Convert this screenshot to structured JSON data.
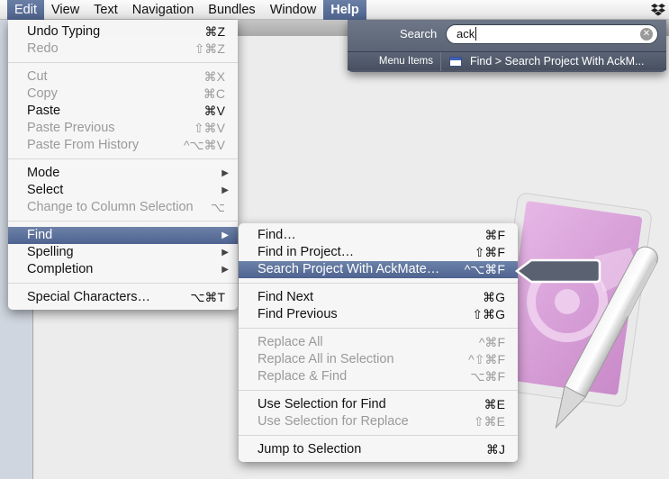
{
  "menubar": {
    "items": [
      "Edit",
      "View",
      "Text",
      "Navigation",
      "Bundles",
      "Window",
      "Help"
    ]
  },
  "icons": {
    "dropbox": "dropbox-icon",
    "clear": "clear-search-icon",
    "result": "menu-item-icon",
    "submenu": "chevron-right-icon"
  },
  "edit_menu": {
    "undo": {
      "label": "Undo Typing",
      "shortcut": "⌘Z"
    },
    "redo": {
      "label": "Redo",
      "shortcut": "⇧⌘Z"
    },
    "cut": {
      "label": "Cut",
      "shortcut": "⌘X"
    },
    "copy": {
      "label": "Copy",
      "shortcut": "⌘C"
    },
    "paste": {
      "label": "Paste",
      "shortcut": "⌘V"
    },
    "paste_previous": {
      "label": "Paste Previous",
      "shortcut": "⇧⌘V"
    },
    "paste_history": {
      "label": "Paste From History",
      "shortcut": "^⌥⌘V"
    },
    "mode": {
      "label": "Mode"
    },
    "select": {
      "label": "Select"
    },
    "column_selection": {
      "label": "Change to Column Selection",
      "shortcut": "⌥"
    },
    "find": {
      "label": "Find"
    },
    "spelling": {
      "label": "Spelling"
    },
    "completion": {
      "label": "Completion"
    },
    "special_chars": {
      "label": "Special Characters…",
      "shortcut": "⌥⌘T"
    }
  },
  "find_menu": {
    "find": {
      "label": "Find…",
      "shortcut": "⌘F"
    },
    "find_in_project": {
      "label": "Find in Project…",
      "shortcut": "⇧⌘F"
    },
    "ackmate": {
      "label": "Search Project With AckMate…",
      "shortcut": "^⌥⌘F"
    },
    "find_next": {
      "label": "Find Next",
      "shortcut": "⌘G"
    },
    "find_previous": {
      "label": "Find Previous",
      "shortcut": "⇧⌘G"
    },
    "replace_all": {
      "label": "Replace All",
      "shortcut": "^⌘F"
    },
    "replace_all_selection": {
      "label": "Replace All in Selection",
      "shortcut": "^⇧⌘F"
    },
    "replace_find": {
      "label": "Replace & Find",
      "shortcut": "⌥⌘F"
    },
    "use_selection_find": {
      "label": "Use Selection for Find",
      "shortcut": "⌘E"
    },
    "use_selection_replace": {
      "label": "Use Selection for Replace",
      "shortcut": "⇧⌘E"
    },
    "jump_selection": {
      "label": "Jump to Selection",
      "shortcut": "⌘J"
    }
  },
  "help_search": {
    "label": "Search",
    "value": "ack",
    "category": "Menu Items",
    "result": "Find > Search Project With AckM..."
  },
  "colors": {
    "highlight": "#5a6f98",
    "popover": "#5b6577",
    "app_icon": "#d9a8dc"
  }
}
